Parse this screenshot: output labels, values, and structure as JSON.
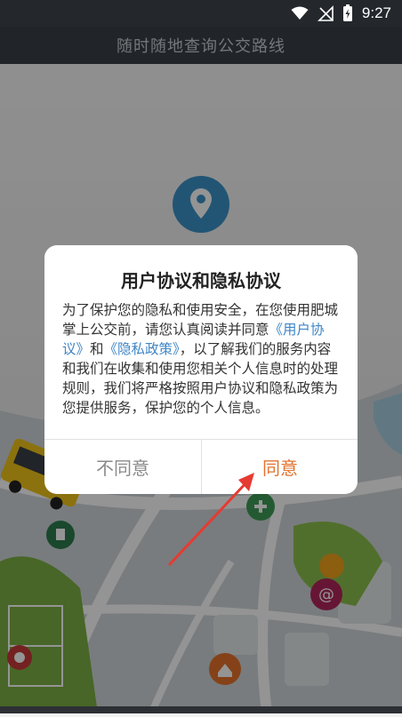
{
  "status_bar": {
    "time": "9:27",
    "icons": [
      "wifi-icon",
      "signal-off-icon",
      "battery-charging-icon"
    ]
  },
  "app_bar": {
    "title": "随时随地查询公交路线"
  },
  "dialog": {
    "title": "用户协议和隐私协议",
    "body": {
      "part1": "为了保护您的隐私和使用安全，在您使用肥城掌上公交前，请您认真阅读并同意",
      "link_user_agreement": "《用户协议》",
      "and": "和",
      "link_privacy_policy": "《隐私政策》",
      "part2": "，以了解我们的服务内容和我们在收集和使用您相关个人信息时的处理规则，我们将严格按照用户协议和隐私政策为您提供服务，保护您的个人信息。"
    },
    "disagree_label": "不同意",
    "agree_label": "同意",
    "colors": {
      "link": "#3f86c7",
      "agree": "#e2732f",
      "arrow": "#e53b32"
    }
  }
}
